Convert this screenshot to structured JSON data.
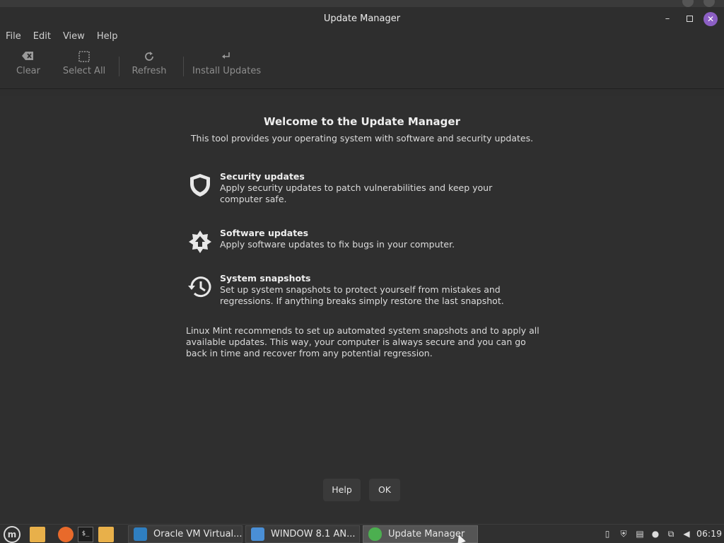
{
  "window": {
    "title": "Update Manager",
    "minimize_glyph": "–",
    "close_glyph": "✕"
  },
  "menubar": [
    "File",
    "Edit",
    "View",
    "Help"
  ],
  "toolbar": {
    "clear": "Clear",
    "select_all": "Select All",
    "refresh": "Refresh",
    "install_updates": "Install Updates"
  },
  "welcome": {
    "title": "Welcome to the Update Manager",
    "subtitle": "This tool provides your operating system with software and security updates."
  },
  "features": [
    {
      "icon": "shield-icon",
      "title": "Security updates",
      "description": "Apply security updates to patch vulnerabilities and keep your computer safe."
    },
    {
      "icon": "upgrade-arrow-icon",
      "title": "Software updates",
      "description": "Apply software updates to fix bugs in your computer."
    },
    {
      "icon": "history-clock-icon",
      "title": "System snapshots",
      "description": "Set up system snapshots to protect yourself from mistakes and regressions. If anything breaks simply restore the last snapshot."
    }
  ],
  "recommendation": "Linux Mint recommends to set up automated system snapshots and to apply all available updates. This way, your computer is always secure and you can go back in time and recover from any potential regression.",
  "buttons": {
    "help": "Help",
    "ok": "OK"
  },
  "taskbar": {
    "tasks": [
      {
        "label": "Oracle VM Virtual..."
      },
      {
        "label": "WINDOW 8.1 AN..."
      },
      {
        "label": "Update Manager"
      }
    ],
    "clock": "06:19",
    "terminal_glyph": "$_"
  },
  "colors": {
    "accent_close": "#8c5fc4",
    "window_bg": "#2e2e2e",
    "content_bg": "#2f2f2f"
  }
}
